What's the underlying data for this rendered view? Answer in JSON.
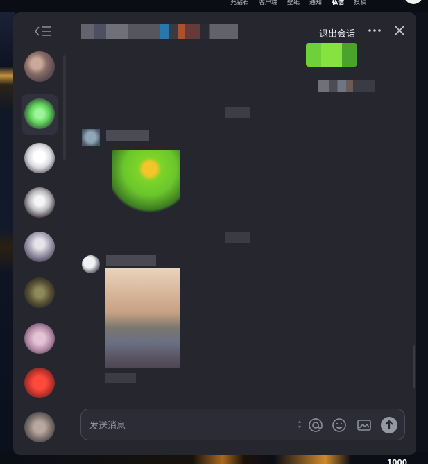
{
  "app": {
    "top_nav": [
      "充钻石",
      "客户端",
      "壁纸",
      "通知",
      "私信",
      "投稿"
    ],
    "active_nav": "私信",
    "corner_number": "1000"
  },
  "chat": {
    "exit_label": "退出会话",
    "more_icon": "more-icon",
    "close_icon": "close-icon",
    "collapse_icon": "collapse-sidebar-icon"
  },
  "composer": {
    "placeholder": "发送消息",
    "icons": [
      "at-icon",
      "emoji-icon",
      "image-icon",
      "send-icon"
    ]
  },
  "colors": {
    "panel_bg": "#26262f",
    "composer_border": "#4a4b57",
    "accent_sticker": "#7ed52a"
  }
}
